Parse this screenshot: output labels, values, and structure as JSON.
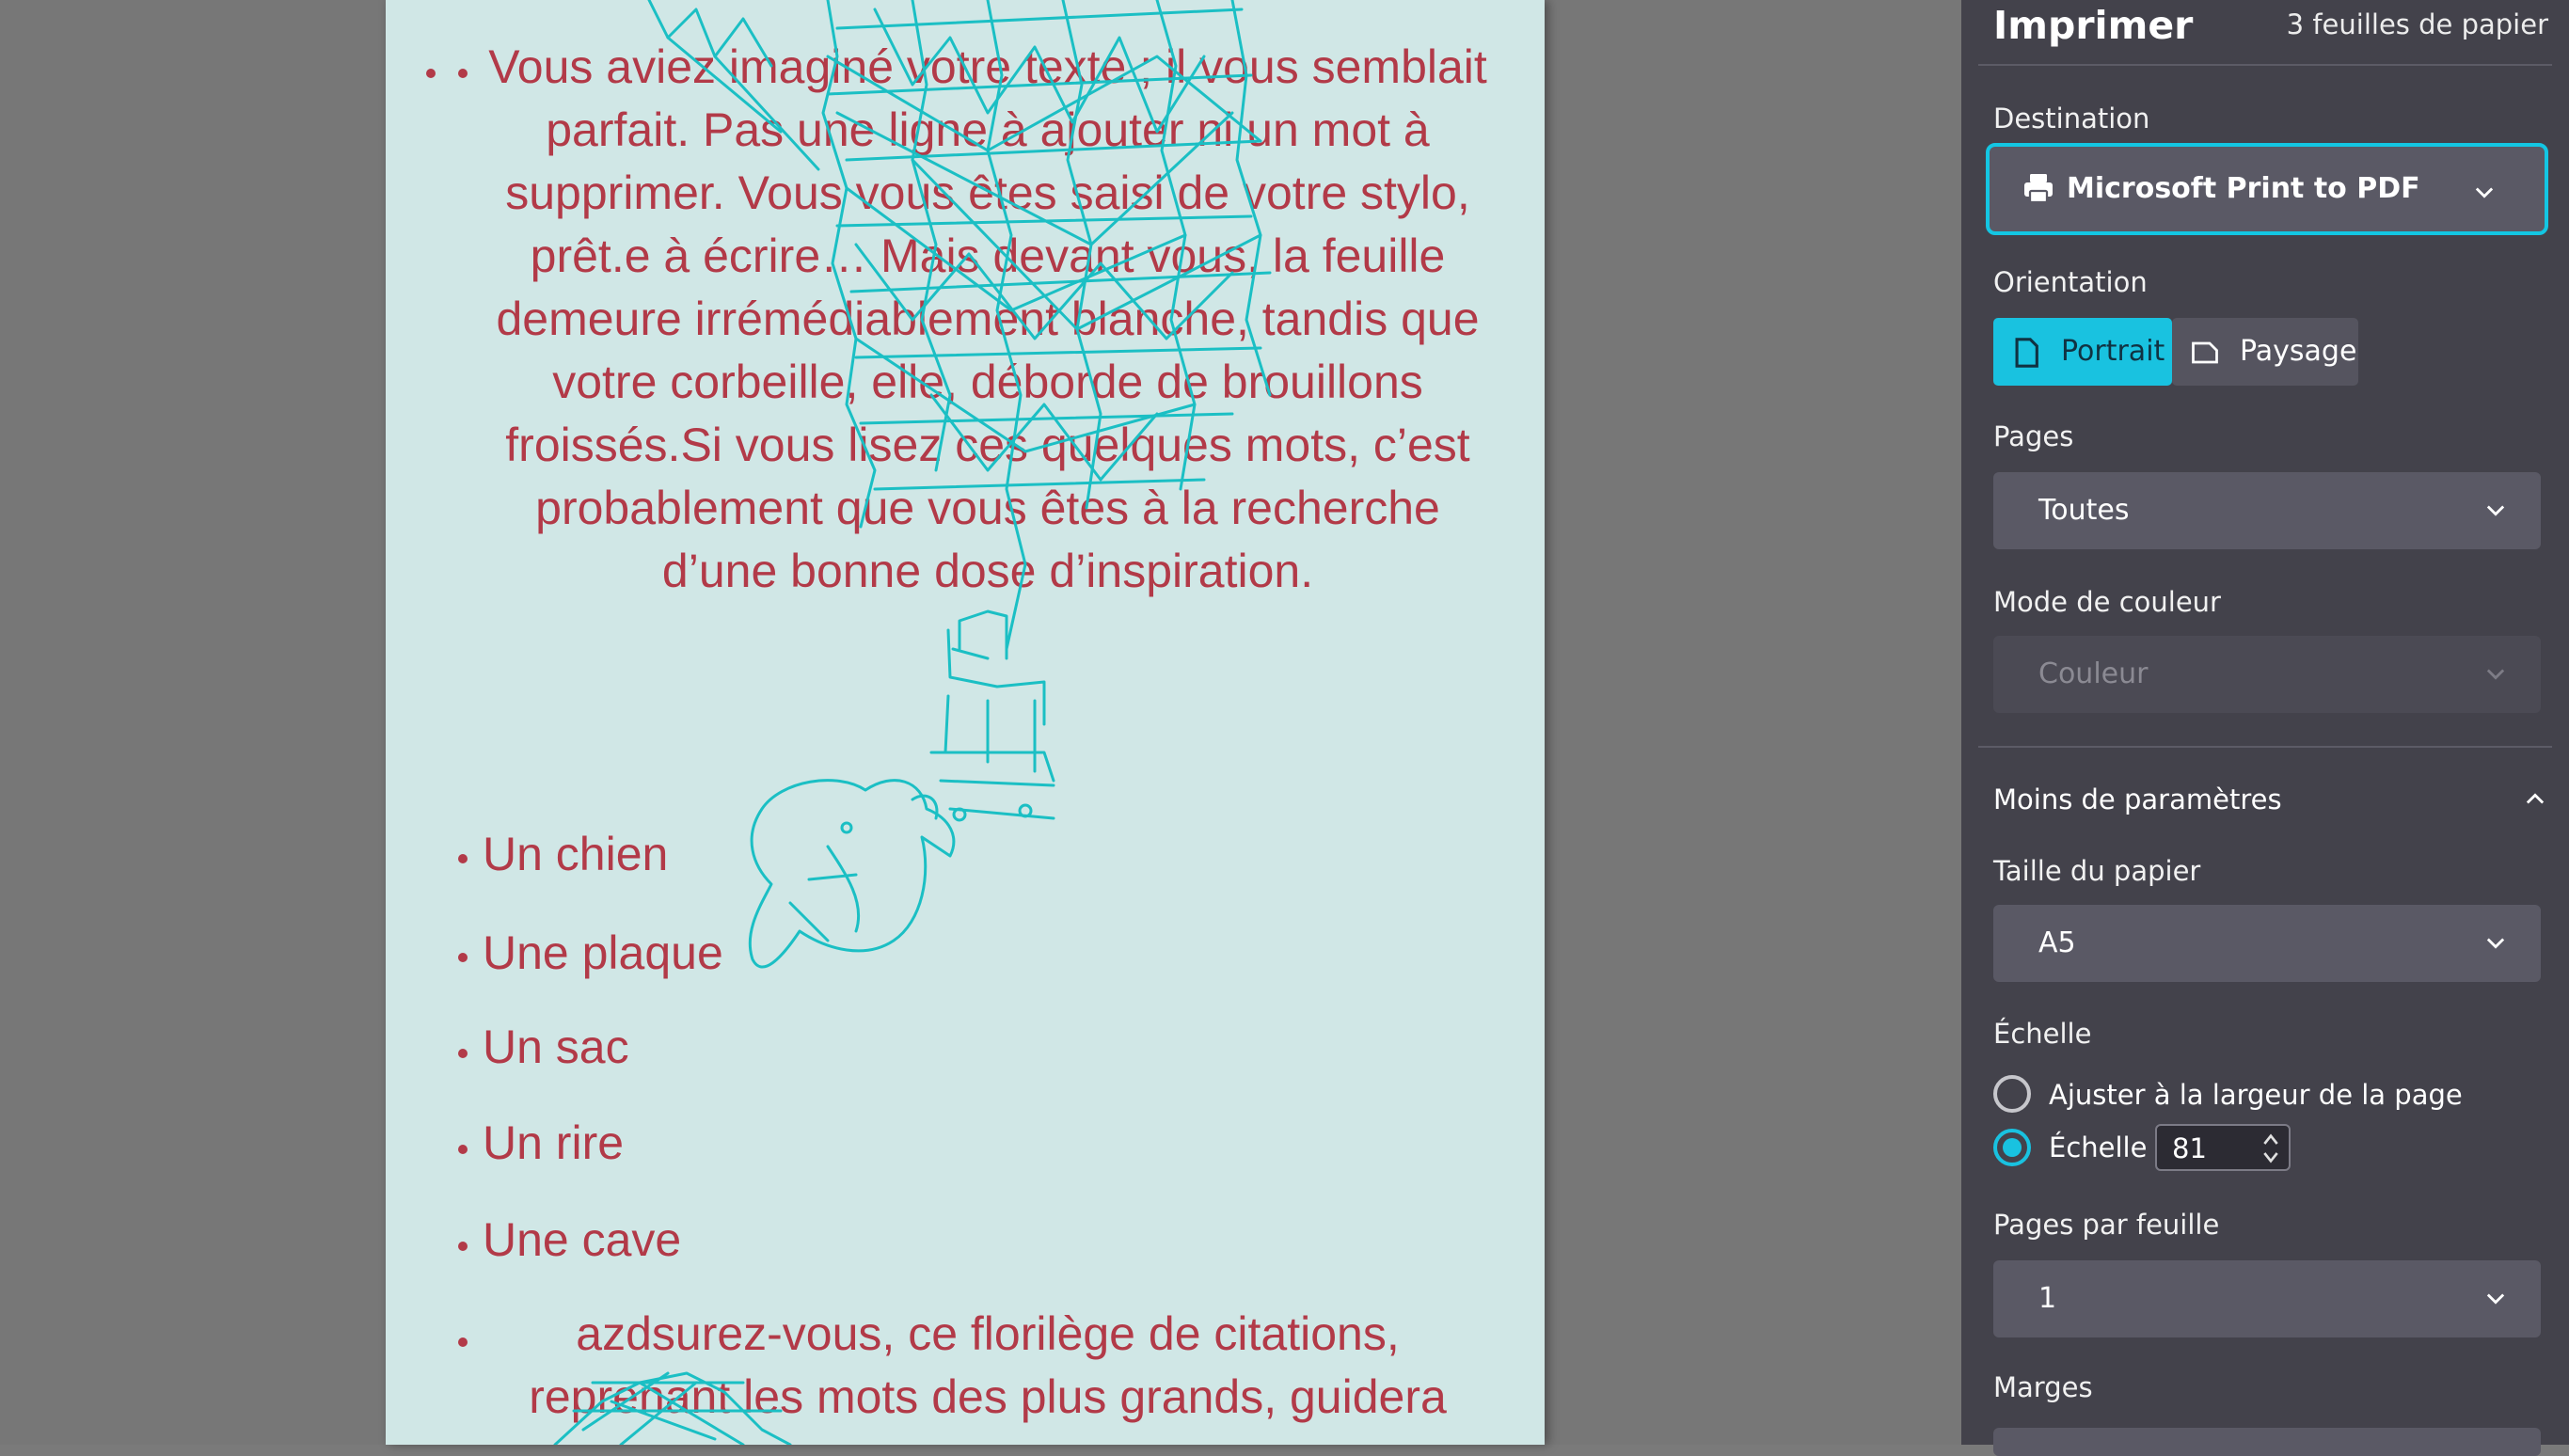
{
  "document": {
    "paragraph1": "Vous aviez imaginé votre texte ; il vous semblait parfait. Pas une ligne à ajouter ni un mot à supprimer. Vous vous êtes saisi de votre stylo, prêt.e à écrire… Mais devant vous, la feuille demeure irrémédiablement blanche, tandis que votre corbeille, elle, déborde de brouillons froissés.Si vous lisez ces quelques mots, c’est probablement que vous êtes à la recherche d’une bonne dose d’inspiration.",
    "items": [
      "Un chien",
      "Une plaque",
      "Un sac",
      "Un rire",
      "Une cave"
    ],
    "paragraph2": "azdsurez-vous, ce florilège de citations, reprenant les mots des plus grands, guidera"
  },
  "panel": {
    "title": "Imprimer",
    "sheet_count": "3 feuilles de papier",
    "destination_label": "Destination",
    "destination_value": "Microsoft Print to PDF",
    "orientation_label": "Orientation",
    "orientation_portrait": "Portrait",
    "orientation_landscape": "Paysage",
    "orientation_selected": "Portrait",
    "pages_label": "Pages",
    "pages_value": "Toutes",
    "color_mode_label": "Mode de couleur",
    "color_mode_value": "Couleur",
    "fewer_settings": "Moins de paramètres",
    "paper_size_label": "Taille du papier",
    "paper_size_value": "A5",
    "scale_label": "Échelle",
    "scale_fit_option": "Ajuster à la largeur de la page",
    "scale_custom_option": "Échelle",
    "scale_value": "81",
    "pages_per_sheet_label": "Pages par feuille",
    "pages_per_sheet_value": "1",
    "margins_label": "Marges"
  },
  "colors": {
    "accent": "#19c2e0",
    "panel_bg": "#43424b",
    "page_bg": "#d0e7e6",
    "text_red": "#b23a48",
    "scribble": "#1bbfc4"
  },
  "icons": [
    "printer-icon",
    "chevron-down-icon",
    "portrait-page-icon",
    "landscape-page-icon",
    "chevron-up-icon",
    "spinner-arrows-icon"
  ]
}
